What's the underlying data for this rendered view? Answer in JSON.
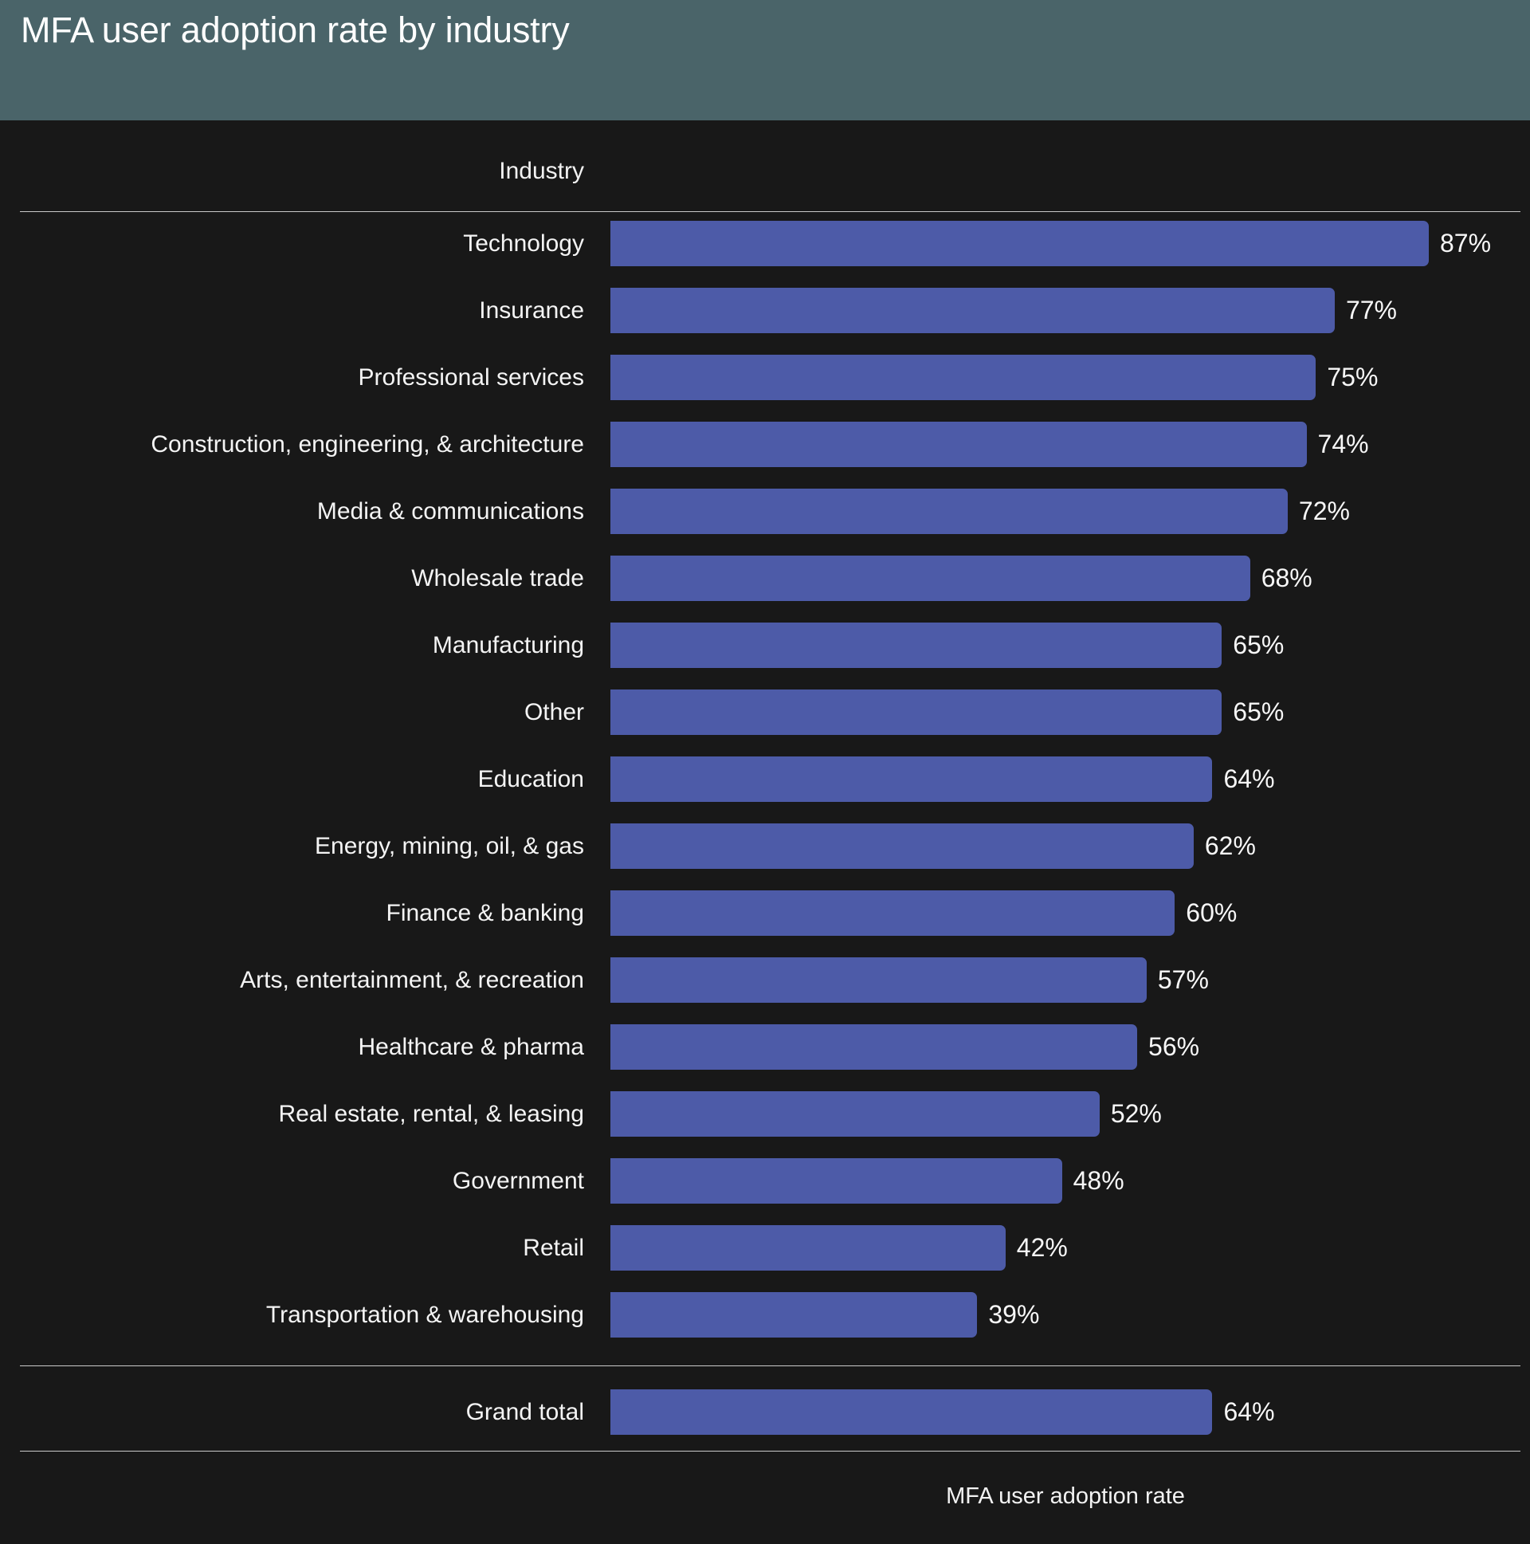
{
  "header": {
    "title": "MFA user adoption rate by industry",
    "band_color": "#4a6469"
  },
  "axes": {
    "category_header": "Industry",
    "value_axis_title": "MFA user adoption rate"
  },
  "theme": {
    "background": "#181818",
    "bar_color": "#4d5ba8",
    "text_color": "#f4f4f4",
    "rule_color": "#c9c9c9"
  },
  "chart_data": {
    "type": "bar",
    "orientation": "horizontal",
    "title": "MFA user adoption rate by industry",
    "xlabel": "MFA user adoption rate",
    "ylabel": "Industry",
    "xlim": [
      0,
      87
    ],
    "grid": false,
    "legend": null,
    "value_suffix": "%",
    "sorted": "descending",
    "categories": [
      "Technology",
      "Insurance",
      "Professional services",
      "Construction, engineering, & architecture",
      "Media & communications",
      "Wholesale trade",
      "Manufacturing",
      "Other",
      "Education",
      "Energy, mining, oil, & gas",
      "Finance & banking",
      "Arts, entertainment, & recreation",
      "Healthcare & pharma",
      "Real estate, rental, & leasing",
      "Government",
      "Retail",
      "Transportation & warehousing"
    ],
    "values": [
      87,
      77,
      75,
      74,
      72,
      68,
      65,
      65,
      64,
      62,
      60,
      57,
      56,
      52,
      48,
      42,
      39
    ],
    "labels": [
      "87%",
      "77%",
      "75%",
      "74%",
      "72%",
      "68%",
      "65%",
      "65%",
      "64%",
      "62%",
      "60%",
      "57%",
      "56%",
      "52%",
      "48%",
      "42%",
      "39%"
    ],
    "grand_total": {
      "category": "Grand total",
      "value": 64,
      "label": "64%"
    }
  }
}
